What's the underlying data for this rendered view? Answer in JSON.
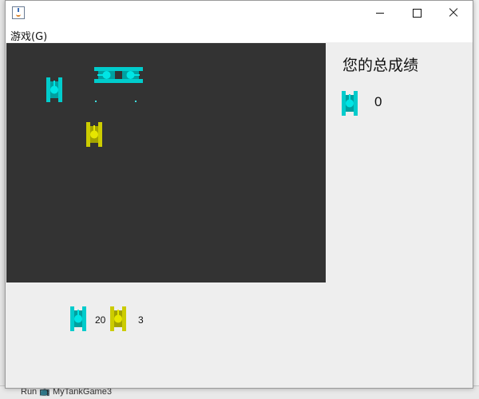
{
  "window": {
    "title": ""
  },
  "menu": {
    "game": "游戏(G)"
  },
  "score": {
    "title": "您的总成绩",
    "value": "0"
  },
  "stats": {
    "enemy_remaining": "20",
    "player_lives": "3"
  },
  "colors": {
    "enemy": "#00cccc",
    "player": "#cccc00",
    "arena_bg": "#333333"
  },
  "background": {
    "run_tab": "Run 📺 MyTankGame3"
  }
}
